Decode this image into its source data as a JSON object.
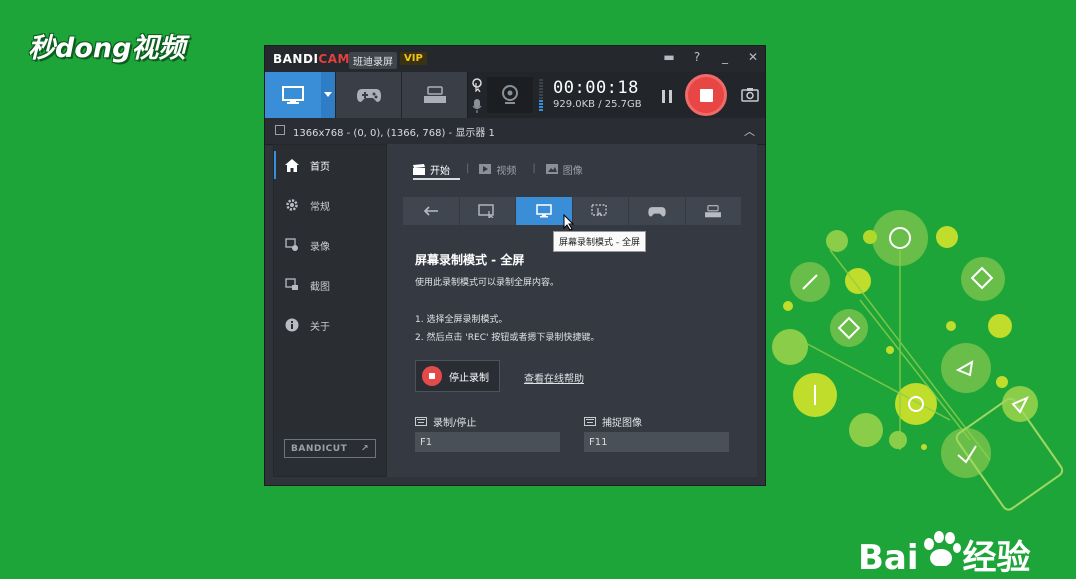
{
  "overlay": {
    "logo_text": "秒dong视频",
    "watermark_brand": "Bai",
    "watermark_text": "经验"
  },
  "app": {
    "brand_prefix": "BANDI",
    "brand_suffix": "CAM",
    "name_tag": "班迪录屏",
    "vip_tag": "VIP",
    "titlebar_icons": [
      "folder-icon",
      "help-icon",
      "minimize-icon",
      "close-icon"
    ],
    "titlebar_glyphs": [
      "▬",
      "?",
      "_",
      "✕"
    ]
  },
  "recording": {
    "timer": "00:00:18",
    "size": "929.0KB / 25.7GB"
  },
  "subbar": {
    "resolution": "1366x768 - (0, 0), (1366, 768) - 显示器 1",
    "collapse": "︿"
  },
  "sidebar": {
    "items": [
      {
        "label": "首页",
        "icon": "home-icon"
      },
      {
        "label": "常规",
        "icon": "gear-icon"
      },
      {
        "label": "录像",
        "icon": "video-settings-icon"
      },
      {
        "label": "截图",
        "icon": "screenshot-icon"
      },
      {
        "label": "关于",
        "icon": "info-icon"
      }
    ],
    "bandicut": "BANDICUT",
    "bandicut_arrow": "↗"
  },
  "content": {
    "tabs": [
      {
        "label": "开始",
        "icon": "clapper-icon"
      },
      {
        "label": "视频",
        "icon": "video-icon"
      },
      {
        "label": "图像",
        "icon": "image-icon"
      }
    ],
    "tab_separator": "|",
    "tooltip": "屏幕录制模式 - 全屏",
    "heading": "屏幕录制模式 - 全屏",
    "description": "使用此录制模式可以录制全屏内容。",
    "step1": "1. 选择全屏录制模式。",
    "step2": "2. 然后点击 'REC' 按钮或者摁下录制快捷键。",
    "stop_button": "停止录制",
    "help_link": "查看在线帮助",
    "hotkeys": {
      "record_label": "录制/停止",
      "record_value": "F1",
      "capture_label": "捕捉图像",
      "capture_value": "F11"
    }
  }
}
